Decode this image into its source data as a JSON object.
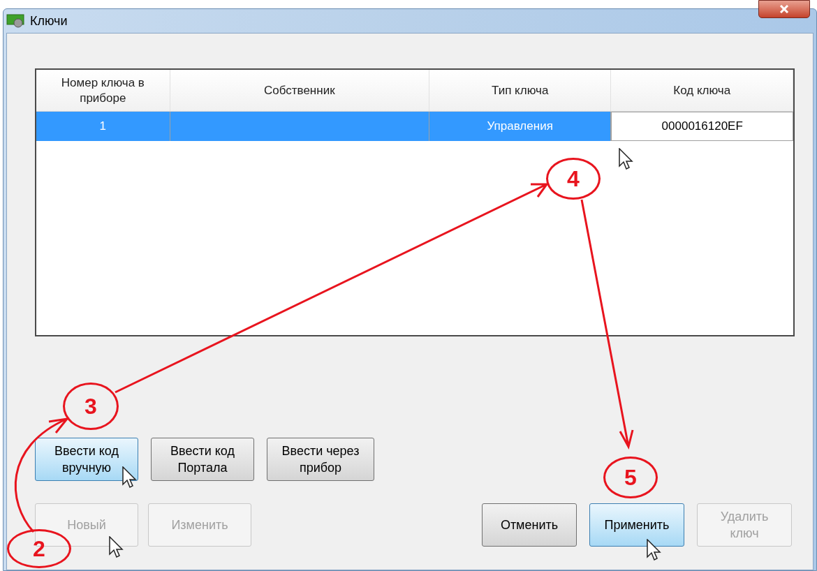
{
  "window": {
    "title": "Ключи"
  },
  "table": {
    "columns": [
      "Номер ключа в приборе",
      "Собственник",
      "Тип ключа",
      "Код ключа"
    ],
    "rows": [
      {
        "selected": true,
        "cells": [
          {
            "text": "1",
            "editing": false
          },
          {
            "editing": false
          },
          {
            "text": "Управления",
            "editing": false
          },
          {
            "text": "0000016120EF",
            "editing": true
          }
        ]
      }
    ]
  },
  "key_buttons": [
    {
      "label": "Ввести код вручную",
      "hovered": true,
      "disabled": false
    },
    {
      "label": "Ввести код Портала",
      "hovered": false,
      "disabled": false
    },
    {
      "label": "Ввести через прибор",
      "hovered": false,
      "disabled": false
    }
  ],
  "edit_buttons": [
    {
      "label": "Новый",
      "disabled": true
    },
    {
      "label": "Изменить",
      "disabled": true
    }
  ],
  "footer_buttons": [
    {
      "label": "Отменить",
      "hovered": false,
      "disabled": false
    },
    {
      "label": "Применить",
      "hovered": true,
      "disabled": false
    },
    {
      "label": "Удалить ключ",
      "disabled": true
    }
  ],
  "annotations": [
    "2",
    "3",
    "4",
    "5"
  ]
}
